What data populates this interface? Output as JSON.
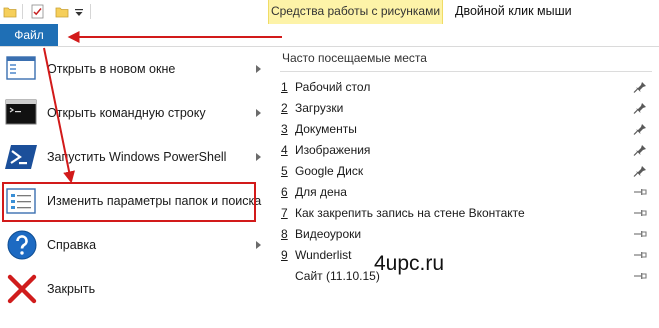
{
  "quick_access": {
    "icons": [
      "folder-icon",
      "properties-check-icon",
      "new-folder-icon",
      "customize-dropdown-icon"
    ]
  },
  "ribbon": {
    "contextual_tab": "Средства работы с рисунками",
    "window_title": "Двойной клик мыши",
    "file_tab": "Файл"
  },
  "menu": {
    "items": [
      {
        "label": "Открыть в новом окне",
        "icon": "new-window-icon",
        "has_submenu": true
      },
      {
        "label": "Открыть командную строку",
        "icon": "command-prompt-icon",
        "has_submenu": true
      },
      {
        "label": "Запустить Windows PowerShell",
        "icon": "powershell-icon",
        "has_submenu": true
      },
      {
        "label": "Изменить параметры папок и поиска",
        "icon": "folder-options-icon",
        "has_submenu": false
      },
      {
        "label": "Справка",
        "icon": "help-icon",
        "has_submenu": true
      },
      {
        "label": "Закрыть",
        "icon": "close-icon",
        "has_submenu": false
      }
    ]
  },
  "recent": {
    "header": "Часто посещаемые места",
    "items": [
      {
        "num": "1",
        "label": "Рабочий стол",
        "pinned": true
      },
      {
        "num": "2",
        "label": "Загрузки",
        "pinned": true
      },
      {
        "num": "3",
        "label": "Документы",
        "pinned": true
      },
      {
        "num": "4",
        "label": "Изображения",
        "pinned": true
      },
      {
        "num": "5",
        "label": "Google Диск",
        "pinned": true
      },
      {
        "num": "6",
        "label": "Для дена",
        "pinned": false
      },
      {
        "num": "7",
        "label": "Как закрепить запись на стене Вконтакте",
        "pinned": false
      },
      {
        "num": "8",
        "label": "Видеоуроки",
        "pinned": false
      },
      {
        "num": "9",
        "label": "Wunderlist",
        "pinned": false
      },
      {
        "num": "",
        "label": "Сайт (11.10.15)",
        "pinned": false
      }
    ]
  },
  "watermark": "4upc.ru",
  "colors": {
    "file_tab": "#1f6fb5",
    "contextual_tab": "#fdf3a8",
    "annotation_red": "#d21a1a"
  }
}
